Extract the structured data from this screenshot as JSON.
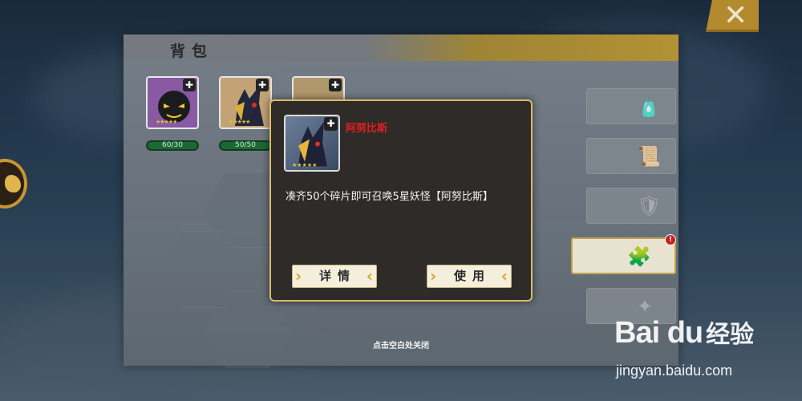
{
  "panel": {
    "title": "背包"
  },
  "items": [
    {
      "count": "60/30",
      "stars": "★★★★★",
      "bg": "#8e5aa8"
    },
    {
      "count": "50/50",
      "stars": "★★★★★",
      "bg": "#c9a778"
    },
    {
      "count": "",
      "stars": "",
      "bg": "#b79c6e"
    }
  ],
  "tabs": [
    {
      "icon": "bottle-icon",
      "glyph": "🧴",
      "active": false
    },
    {
      "icon": "scroll-icon",
      "glyph": "📜",
      "active": false
    },
    {
      "icon": "armor-icon",
      "glyph": "🛡",
      "active": false
    },
    {
      "icon": "puzzle-piece-icon",
      "glyph": "🧩",
      "active": true,
      "badge": "!"
    },
    {
      "icon": "star-burst-icon",
      "glyph": "✦",
      "active": false
    }
  ],
  "modal": {
    "item_name": "阿努比斯",
    "item_stars": "★★★★★",
    "description": "凑齐50个碎片即可召唤5星妖怪【阿努比斯】",
    "details_button": "详情",
    "use_button": "使用"
  },
  "hint": "点击空白处关闭",
  "close_glyph": "✕",
  "watermark": {
    "brand": "Bai du",
    "cn": "经验",
    "url": "jingyan.baidu.com"
  },
  "colors": {
    "accent_gold": "#d9bb6a",
    "name_red": "#e02020",
    "count_green": "#1c6a34"
  }
}
